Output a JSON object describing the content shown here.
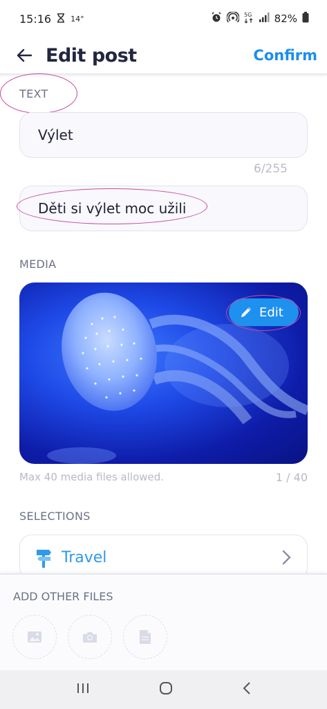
{
  "status": {
    "time": "15:16",
    "temp": "14°",
    "battery": "82%"
  },
  "header": {
    "title": "Edit post",
    "confirm_label": "Confirm"
  },
  "text_section": {
    "label": "TEXT",
    "title_value": "Výlet",
    "counter": "6/255",
    "description_value": "Děti si výlet moc užili"
  },
  "media_section": {
    "label": "MEDIA",
    "edit_label": "Edit",
    "info": "Max 40 media files allowed.",
    "count": "1 / 40"
  },
  "selections_section": {
    "label": "SELECTIONS",
    "item_label": "Travel"
  },
  "other_files": {
    "label": "ADD OTHER FILES",
    "buttons": [
      "image-icon",
      "camera-icon",
      "document-icon"
    ]
  },
  "colors": {
    "accent": "#1a8ef0",
    "annotation": "#c64a9e"
  }
}
